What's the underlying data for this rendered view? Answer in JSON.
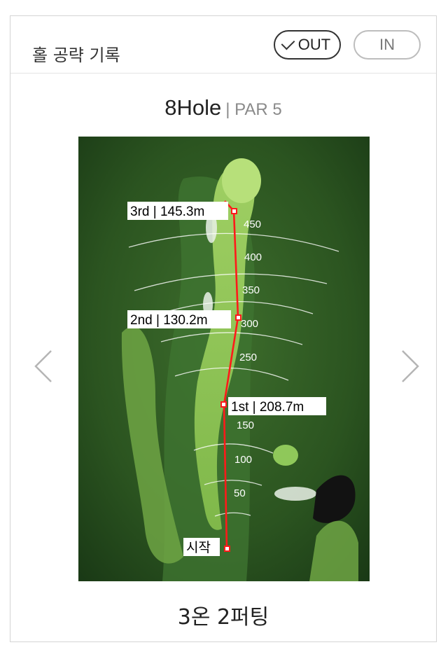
{
  "header": {
    "title": "홀 공략 기록",
    "toggle_out": "OUT",
    "toggle_in": "IN"
  },
  "hole": {
    "number": "8Hole",
    "par": "| PAR 5"
  },
  "map": {
    "distance_labels": [
      "450",
      "400",
      "350",
      "300",
      "250",
      "150",
      "100",
      "50"
    ],
    "shots": [
      {
        "label": "3rd | 145.3m"
      },
      {
        "label": "2nd | 130.2m"
      },
      {
        "label": "1st | 208.7m"
      },
      {
        "label": "시작"
      }
    ],
    "colors": {
      "route": "#ff1a1a",
      "fairway": "#8bc34a",
      "rough": "#2f5a23"
    }
  },
  "result": "3온 2퍼팅"
}
